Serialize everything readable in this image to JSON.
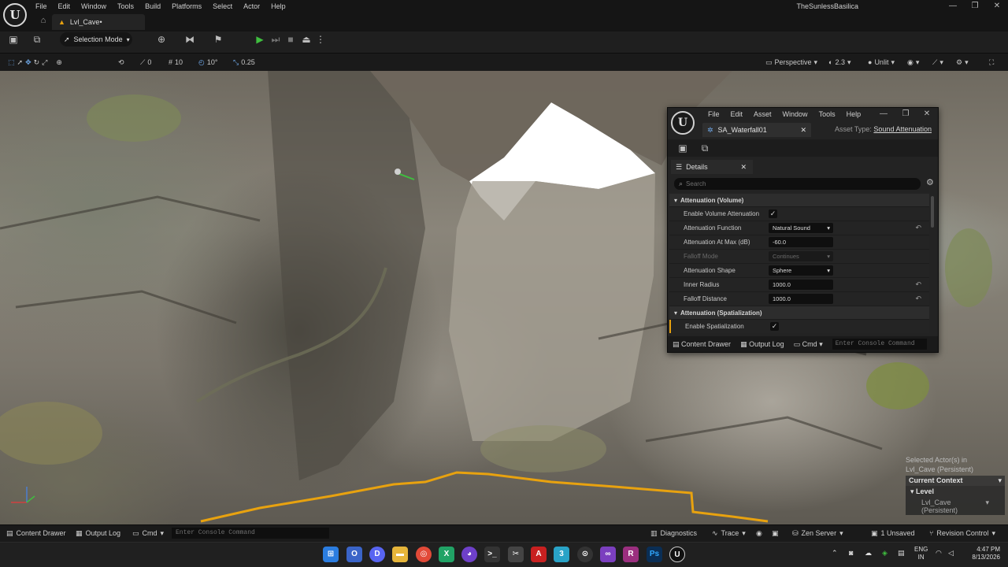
{
  "app": {
    "menu": [
      "File",
      "Edit",
      "Window",
      "Tools",
      "Build",
      "Platforms",
      "Select",
      "Actor",
      "Help"
    ],
    "project_name": "TheSunlessBasilica",
    "level_tab": "Lvl_Cave•",
    "window_controls": [
      "—",
      "❐",
      "✕"
    ]
  },
  "toolbar": {
    "mode": "Selection Mode"
  },
  "viewport_toolbar": {
    "snap_rotation": "0",
    "grid_size": "10",
    "rotation_snap": "10°",
    "scale_snap": "0.25",
    "view_mode": "Perspective",
    "camera_speed": "2.3",
    "lighting": "Unlit"
  },
  "asset_editor": {
    "menu": [
      "File",
      "Edit",
      "Asset",
      "Window",
      "Tools",
      "Help"
    ],
    "tab": "SA_Waterfall01",
    "asset_type_label": "Asset Type:",
    "asset_type": "Sound Attenuation",
    "details_tab": "Details",
    "search_placeholder": "Search",
    "sections": [
      {
        "title": "Attenuation (Volume)",
        "rows": [
          {
            "label": "Enable Volume Attenuation",
            "checkbox": true
          },
          {
            "label": "Attenuation Function",
            "value": "Natural Sound",
            "dropdown": true,
            "reset": true
          },
          {
            "label": "Attenuation At Max (dB)",
            "value": "-60.0"
          },
          {
            "label": "Falloff Mode",
            "value": "Continues",
            "dropdown": true,
            "disabled": true
          },
          {
            "label": "Attenuation Shape",
            "value": "Sphere",
            "dropdown": true
          },
          {
            "label": "Inner Radius",
            "value": "1000.0",
            "reset": true
          },
          {
            "label": "Falloff Distance",
            "value": "1000.0",
            "reset": true
          }
        ]
      },
      {
        "title": "Attenuation (Spatialization)",
        "rows": [
          {
            "label": "Enable Spatialization",
            "checkbox": true
          }
        ]
      }
    ],
    "bottom": {
      "content_drawer": "Content Drawer",
      "output_log": "Output Log",
      "cmd": "Cmd",
      "console_placeholder": "Enter Console Command"
    }
  },
  "context_panel": {
    "selected_line1": "Selected Actor(s) in",
    "selected_line2": "Lvl_Cave (Persistent)",
    "current_context": "Current Context",
    "level": "Level",
    "level_name": "Lvl_Cave (Persistent)"
  },
  "statusbar": {
    "content_drawer": "Content Drawer",
    "output_log": "Output Log",
    "cmd": "Cmd",
    "console_placeholder": "Enter Console Command",
    "diagnostics": "Diagnostics",
    "trace": "Trace",
    "zen_server": "Zen Server",
    "unsaved": "1 Unsaved",
    "revision_control": "Revision Control"
  },
  "taskbar": {
    "lang_line1": "ENG",
    "lang_line2": "IN",
    "time": "4:47 PM",
    "date": "8/13/2026"
  },
  "colors": {
    "accent_green": "#3fbf3f",
    "selection_orange": "#e8a20f",
    "panel_bg": "#232323",
    "statusbar_bg": "#1a1a1a"
  }
}
